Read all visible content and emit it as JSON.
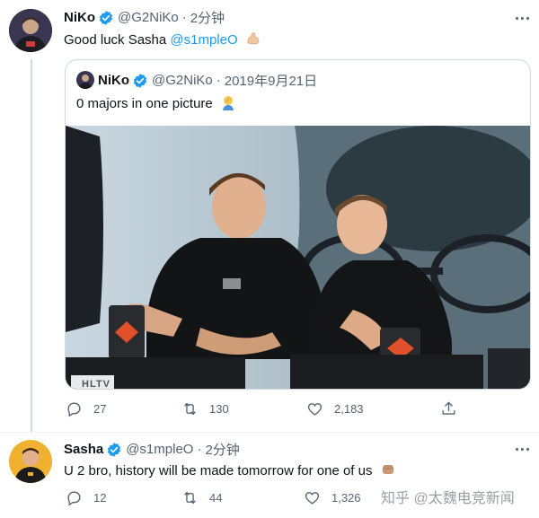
{
  "tweet1": {
    "name": "NiKo",
    "handle": "@G2NiKo",
    "separator": "·",
    "time": "2分钟",
    "text_prefix": "Good luck Sasha ",
    "mention": "@s1mpleO",
    "emoji": "muscle-emoji"
  },
  "quoted": {
    "name": "NiKo",
    "handle": "@G2NiKo",
    "separator": "·",
    "date": "2019年9月21日",
    "text": "0 majors in one picture",
    "emoji": "facepalm-emoji",
    "photo_caption": "HLTV"
  },
  "tweet1_actions": {
    "reply_count": "27",
    "retweet_count": "130",
    "like_count": "2,183"
  },
  "tweet2": {
    "name": "Sasha",
    "handle": "@s1mpleO",
    "separator": "·",
    "time": "2分钟",
    "text": "U 2 bro, history will be made tomorrow for one of us",
    "emoji": "fist-emoji"
  },
  "tweet2_actions": {
    "reply_count": "12",
    "retweet_count": "44",
    "like_count": "1,326"
  },
  "watermark": "知乎 @太魏电竞新闻",
  "colors": {
    "accent": "#1d9bf0",
    "secondary_text": "#536471",
    "primary_text": "#0f1419",
    "border": "#cfd9de"
  }
}
